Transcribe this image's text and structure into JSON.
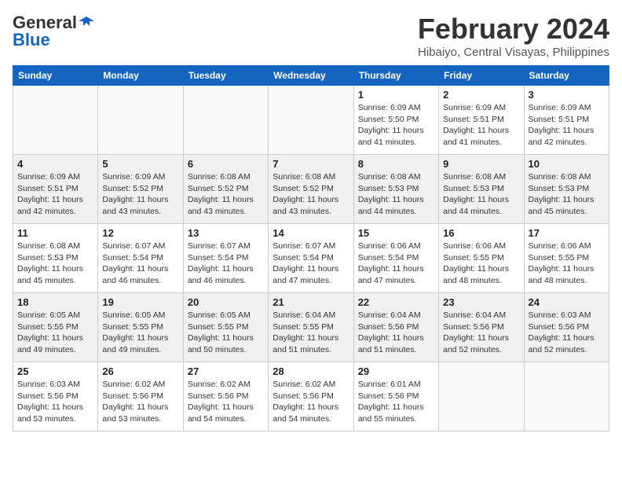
{
  "logo": {
    "line1": "General",
    "line2": "Blue"
  },
  "title": "February 2024",
  "location": "Hibaiyo, Central Visayas, Philippines",
  "days_header": [
    "Sunday",
    "Monday",
    "Tuesday",
    "Wednesday",
    "Thursday",
    "Friday",
    "Saturday"
  ],
  "weeks": [
    [
      {
        "day": "",
        "info": ""
      },
      {
        "day": "",
        "info": ""
      },
      {
        "day": "",
        "info": ""
      },
      {
        "day": "",
        "info": ""
      },
      {
        "day": "1",
        "info": "Sunrise: 6:09 AM\nSunset: 5:50 PM\nDaylight: 11 hours\nand 41 minutes."
      },
      {
        "day": "2",
        "info": "Sunrise: 6:09 AM\nSunset: 5:51 PM\nDaylight: 11 hours\nand 41 minutes."
      },
      {
        "day": "3",
        "info": "Sunrise: 6:09 AM\nSunset: 5:51 PM\nDaylight: 11 hours\nand 42 minutes."
      }
    ],
    [
      {
        "day": "4",
        "info": "Sunrise: 6:09 AM\nSunset: 5:51 PM\nDaylight: 11 hours\nand 42 minutes."
      },
      {
        "day": "5",
        "info": "Sunrise: 6:09 AM\nSunset: 5:52 PM\nDaylight: 11 hours\nand 43 minutes."
      },
      {
        "day": "6",
        "info": "Sunrise: 6:08 AM\nSunset: 5:52 PM\nDaylight: 11 hours\nand 43 minutes."
      },
      {
        "day": "7",
        "info": "Sunrise: 6:08 AM\nSunset: 5:52 PM\nDaylight: 11 hours\nand 43 minutes."
      },
      {
        "day": "8",
        "info": "Sunrise: 6:08 AM\nSunset: 5:53 PM\nDaylight: 11 hours\nand 44 minutes."
      },
      {
        "day": "9",
        "info": "Sunrise: 6:08 AM\nSunset: 5:53 PM\nDaylight: 11 hours\nand 44 minutes."
      },
      {
        "day": "10",
        "info": "Sunrise: 6:08 AM\nSunset: 5:53 PM\nDaylight: 11 hours\nand 45 minutes."
      }
    ],
    [
      {
        "day": "11",
        "info": "Sunrise: 6:08 AM\nSunset: 5:53 PM\nDaylight: 11 hours\nand 45 minutes."
      },
      {
        "day": "12",
        "info": "Sunrise: 6:07 AM\nSunset: 5:54 PM\nDaylight: 11 hours\nand 46 minutes."
      },
      {
        "day": "13",
        "info": "Sunrise: 6:07 AM\nSunset: 5:54 PM\nDaylight: 11 hours\nand 46 minutes."
      },
      {
        "day": "14",
        "info": "Sunrise: 6:07 AM\nSunset: 5:54 PM\nDaylight: 11 hours\nand 47 minutes."
      },
      {
        "day": "15",
        "info": "Sunrise: 6:06 AM\nSunset: 5:54 PM\nDaylight: 11 hours\nand 47 minutes."
      },
      {
        "day": "16",
        "info": "Sunrise: 6:06 AM\nSunset: 5:55 PM\nDaylight: 11 hours\nand 48 minutes."
      },
      {
        "day": "17",
        "info": "Sunrise: 6:06 AM\nSunset: 5:55 PM\nDaylight: 11 hours\nand 48 minutes."
      }
    ],
    [
      {
        "day": "18",
        "info": "Sunrise: 6:05 AM\nSunset: 5:55 PM\nDaylight: 11 hours\nand 49 minutes."
      },
      {
        "day": "19",
        "info": "Sunrise: 6:05 AM\nSunset: 5:55 PM\nDaylight: 11 hours\nand 49 minutes."
      },
      {
        "day": "20",
        "info": "Sunrise: 6:05 AM\nSunset: 5:55 PM\nDaylight: 11 hours\nand 50 minutes."
      },
      {
        "day": "21",
        "info": "Sunrise: 6:04 AM\nSunset: 5:55 PM\nDaylight: 11 hours\nand 51 minutes."
      },
      {
        "day": "22",
        "info": "Sunrise: 6:04 AM\nSunset: 5:56 PM\nDaylight: 11 hours\nand 51 minutes."
      },
      {
        "day": "23",
        "info": "Sunrise: 6:04 AM\nSunset: 5:56 PM\nDaylight: 11 hours\nand 52 minutes."
      },
      {
        "day": "24",
        "info": "Sunrise: 6:03 AM\nSunset: 5:56 PM\nDaylight: 11 hours\nand 52 minutes."
      }
    ],
    [
      {
        "day": "25",
        "info": "Sunrise: 6:03 AM\nSunset: 5:56 PM\nDaylight: 11 hours\nand 53 minutes."
      },
      {
        "day": "26",
        "info": "Sunrise: 6:02 AM\nSunset: 5:56 PM\nDaylight: 11 hours\nand 53 minutes."
      },
      {
        "day": "27",
        "info": "Sunrise: 6:02 AM\nSunset: 5:56 PM\nDaylight: 11 hours\nand 54 minutes."
      },
      {
        "day": "28",
        "info": "Sunrise: 6:02 AM\nSunset: 5:56 PM\nDaylight: 11 hours\nand 54 minutes."
      },
      {
        "day": "29",
        "info": "Sunrise: 6:01 AM\nSunset: 5:56 PM\nDaylight: 11 hours\nand 55 minutes."
      },
      {
        "day": "",
        "info": ""
      },
      {
        "day": "",
        "info": ""
      }
    ]
  ]
}
